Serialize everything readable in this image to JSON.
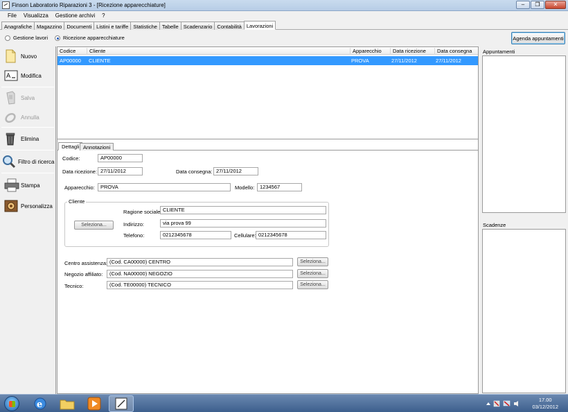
{
  "window": {
    "title": "Finson Laboratorio Riparazioni 3 - [Ricezione apparecchiature]",
    "minimize": "–",
    "restore": "❐",
    "close": "✕"
  },
  "menu": [
    "File",
    "Visualizza",
    "Gestione archivi",
    "?"
  ],
  "tabs": [
    "Anagrafiche",
    "Magazzino",
    "Documenti",
    "Listini e tariffe",
    "Statistiche",
    "Tabelle",
    "Scadenzario",
    "Contabilità",
    "Lavorazioni"
  ],
  "mode": {
    "option1": "Gestione lavori",
    "option2": "Ricezione apparecchiature",
    "agenda_button": "Agenda appuntamenti"
  },
  "sidebar": {
    "nuovo": "Nuovo",
    "modifica": "Modifica",
    "salva": "Salva",
    "annulla": "Annulla",
    "elimina": "Elimina",
    "filtro": "Filtro di ricerca",
    "stampa": "Stampa",
    "personalizza": "Personalizza"
  },
  "grid": {
    "columns": [
      "Codice",
      "Cliente",
      "Apparecchio",
      "Data ricezione",
      "Data consegna"
    ],
    "rows": [
      [
        "AP00000",
        "CLIENTE",
        "PROVA",
        "27/11/2012",
        "27/11/2012"
      ]
    ]
  },
  "detail": {
    "tab_dettagli": "Dettagli",
    "tab_annotazioni": "Annotazioni",
    "codice_label": "Codice:",
    "codice": "AP00000",
    "data_ricezione_label": "Data ricezione:",
    "data_ricezione": "27/11/2012",
    "data_consegna_label": "Data consegna:",
    "data_consegna": "27/11/2012",
    "apparecchio_label": "Apparecchio:",
    "apparecchio": "PROVA",
    "modello_label": "Modello:",
    "modello": "1234567",
    "cliente_group": "Cliente",
    "seleziona_cliente": "Seleziona...",
    "ragione_label": "Ragione sociale:",
    "ragione": "CLIENTE",
    "indirizzo_label": "Indirizzo:",
    "indirizzo": "via prova 99",
    "telefono_label": "Telefono:",
    "telefono": "0212345678",
    "cellulare_label": "Cellulare:",
    "cellulare": "0212345678",
    "centro_label": "Centro assistenza:",
    "centro": "(Cod. CA00000) CENTRO",
    "negozio_label": "Negozio affiliato:",
    "negozio": "(Cod. NA00000) NEGOZIO",
    "tecnico_label": "Tecnico:",
    "tecnico": "(Cod. TE00000) TECNICO",
    "seleziona": "Seleziona..."
  },
  "right": {
    "appuntamenti": "Appuntamenti",
    "scadenze": "Scadenze"
  },
  "taskbar": {
    "time": "17.00",
    "date": "03/12/2012"
  }
}
